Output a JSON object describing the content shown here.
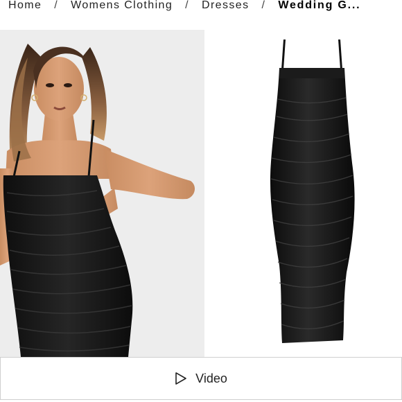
{
  "breadcrumb": {
    "items": [
      "Home",
      "Womens Clothing",
      "Dresses"
    ],
    "current": "Wedding G...",
    "separator": "/"
  },
  "gallery": {
    "model_image": "model-wearing-black-ruched-dress",
    "product_image": "black-ruched-strappy-midi-dress"
  },
  "video": {
    "label": "Video",
    "icon": "play-icon"
  },
  "colors": {
    "dress": "#141414",
    "model_bg": "#ededed",
    "border": "#cfcfcf"
  }
}
